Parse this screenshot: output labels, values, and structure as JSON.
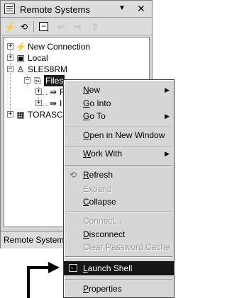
{
  "view": {
    "title": "Remote Systems",
    "menu_glyph": "▼",
    "close_glyph": "✕",
    "tab_label": "Remote Systems",
    "toolbar": [
      {
        "name": "new-connection-icon",
        "glyph": "⚡"
      },
      {
        "name": "refresh-icon",
        "glyph": "⟲"
      },
      {
        "name": "collapse-all-icon",
        "glyph": "−"
      },
      {
        "name": "back-icon",
        "glyph": "⇦"
      },
      {
        "name": "forward-icon",
        "glyph": "⇨"
      },
      {
        "name": "up-icon",
        "glyph": "⇧"
      }
    ]
  },
  "tree": {
    "items": [
      {
        "label": "New Connection",
        "icon": "new-connection-icon",
        "glyph": "⚡",
        "expander": "+"
      },
      {
        "label": "Local",
        "icon": "computer-icon",
        "glyph": "▣",
        "expander": "+"
      },
      {
        "label": "SLES8RM",
        "icon": "linux-system-icon",
        "glyph": "♙",
        "expander": "−"
      },
      {
        "label": "Files",
        "icon": "files-subsystem-icon",
        "glyph": "⎘",
        "expander": "−",
        "selected": true
      },
      {
        "label": "F",
        "icon": "filter-icon",
        "glyph": "⇛",
        "expander": "+"
      },
      {
        "label": "I",
        "icon": "filter-icon",
        "glyph": "⇛",
        "expander": "+"
      },
      {
        "label": "TORASC",
        "icon": "server-icon",
        "glyph": "▦",
        "expander": "+"
      }
    ]
  },
  "context_menu": {
    "items": [
      {
        "kind": "item",
        "pre": "",
        "u": "N",
        "post": "ew",
        "arrow": "▶",
        "name": "menu-new"
      },
      {
        "kind": "item",
        "pre": "",
        "u": "G",
        "post": "o Into",
        "name": "menu-go-into"
      },
      {
        "kind": "item",
        "pre": "",
        "u": "G",
        "post": "o To",
        "arrow": "▶",
        "name": "menu-go-to"
      },
      {
        "kind": "sep"
      },
      {
        "kind": "item",
        "pre": "",
        "u": "O",
        "post": "pen in New Window",
        "name": "menu-open-new-window"
      },
      {
        "kind": "sep"
      },
      {
        "kind": "item",
        "pre": "",
        "u": "W",
        "post": "ork With",
        "arrow": "▶",
        "name": "menu-work-with"
      },
      {
        "kind": "sep"
      },
      {
        "kind": "item",
        "pre": "",
        "u": "R",
        "post": "efresh",
        "icon": "refresh-icon",
        "glyph": "⟲",
        "name": "menu-refresh"
      },
      {
        "kind": "item",
        "pre": "",
        "u": "",
        "post": "Expand",
        "disabled": true,
        "name": "menu-expand"
      },
      {
        "kind": "item",
        "pre": "",
        "u": "C",
        "post": "ollapse",
        "name": "menu-collapse"
      },
      {
        "kind": "sep"
      },
      {
        "kind": "item",
        "pre": "",
        "u": "",
        "post": "Connect...",
        "disabled": true,
        "name": "menu-connect"
      },
      {
        "kind": "item",
        "pre": "",
        "u": "D",
        "post": "isconnect",
        "name": "menu-disconnect"
      },
      {
        "kind": "item",
        "pre": "",
        "u": "",
        "post": "Clear Password Cache",
        "disabled": true,
        "name": "menu-clear-password-cache"
      },
      {
        "kind": "sep"
      },
      {
        "kind": "item",
        "pre": "",
        "u": "L",
        "post": "aunch Shell",
        "icon": "terminal-icon",
        "highlighted": true,
        "name": "menu-launch-shell"
      },
      {
        "kind": "sep"
      },
      {
        "kind": "item",
        "pre": "",
        "u": "P",
        "post": "roperties",
        "name": "menu-properties"
      }
    ]
  }
}
